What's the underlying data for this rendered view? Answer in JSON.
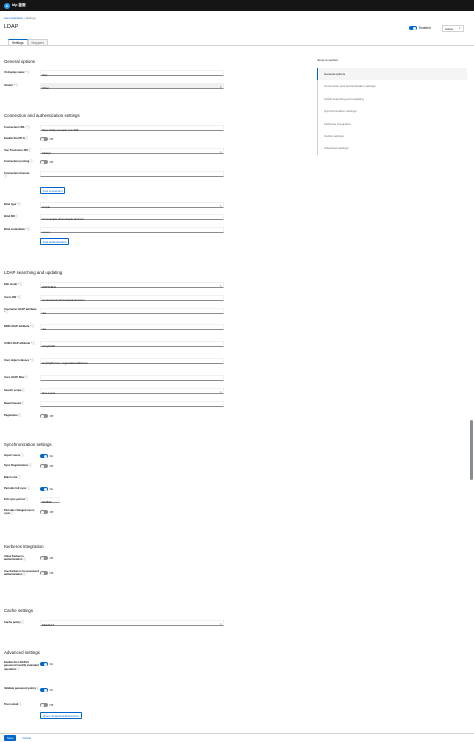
{
  "header": {
    "brand": "Idp 鉴面",
    "logo_letter": "K"
  },
  "breadcrumb": {
    "parent": "User federation",
    "separator": "›",
    "current": "Settings"
  },
  "page": {
    "title": "LDAP",
    "enabled_label": "Enabled",
    "action_label": "Action",
    "enabled": true
  },
  "tabs": [
    {
      "label": "Settings",
      "active": true
    },
    {
      "label": "Mappers",
      "active": false
    }
  ],
  "jump": {
    "title": "Jump to section",
    "items": [
      {
        "label": "General options",
        "active": true
      },
      {
        "label": "Connection and authentication settings",
        "active": false
      },
      {
        "label": "LDAP searching and updating",
        "active": false
      },
      {
        "label": "Synchronization settings",
        "active": false
      },
      {
        "label": "Kerberos integration",
        "active": false
      },
      {
        "label": "Cache settings",
        "active": false
      },
      {
        "label": "Advanced settings",
        "active": false
      }
    ]
  },
  "general": {
    "title": "General options",
    "ui_display_name_label": "UI display name",
    "ui_display_name_value": "ldap",
    "vendor_label": "Vendor",
    "vendor_value": "Other"
  },
  "connection": {
    "title": "Connection and authentication settings",
    "url_label": "Connection URL",
    "url_value": "https://ldap.example.com:636",
    "starttls_label": "Enable StartTLS",
    "starttls_state": "Off",
    "truststore_label": "Use Truststore SPI",
    "truststore_value": "Always",
    "pooling_label": "Connection pooling",
    "pooling_state": "Off",
    "timeout_label": "Connection timeout",
    "timeout_value": "",
    "test_connection": "Test connection",
    "bind_type_label": "Bind type",
    "bind_type_value": "simple",
    "bind_dn_label": "Bind DN",
    "bind_dn_value": "cn=example,dc=example,dc=com",
    "bind_cred_label": "Bind credentials",
    "bind_cred_value": "••••••••",
    "test_auth": "Test authentication"
  },
  "searching": {
    "title": "LDAP searching and updating",
    "edit_mode_label": "Edit mode",
    "edit_mode_value": "WRITABLE",
    "users_dn_label": "Users DN",
    "users_dn_value": "ou=accounts,dc=example,dc=com",
    "username_attr_label": "Username LDAP attribute",
    "username_attr_value": "uid",
    "rdn_attr_label": "RDN LDAP attribute",
    "rdn_attr_value": "uid",
    "uuid_attr_label": "UUID LDAP attribute",
    "uuid_attr_value": "entryUUID",
    "object_classes_label": "User object classes",
    "object_classes_value": "inetOrgPerson, organizationalPerson",
    "user_filter_label": "User LDAP filter",
    "user_filter_value": "",
    "search_scope_label": "Search scope",
    "search_scope_value": "One Level",
    "read_timeout_label": "Read timeout",
    "read_timeout_value": "",
    "pagination_label": "Pagination",
    "pagination_state": "Off"
  },
  "sync": {
    "title": "Synchronization settings",
    "import_label": "Import users",
    "import_state": "On",
    "sync_reg_label": "Sync Registrations",
    "sync_reg_state": "Off",
    "batch_label": "Batch size",
    "batch_value": "",
    "full_sync_label": "Periodic full sync",
    "full_sync_state": "On",
    "full_period_label": "Full sync period",
    "full_period_value": "604800",
    "changed_sync_label": "Periodic changed users sync",
    "changed_sync_state": "Off"
  },
  "kerberos": {
    "title": "Kerberos integration",
    "allow_label": "Allow Kerberos authentication",
    "allow_state": "Off",
    "use_pw_label": "Use Kerberos for password authentication",
    "use_pw_state": "Off"
  },
  "cache": {
    "title": "Cache settings",
    "policy_label": "Cache policy",
    "policy_value": "DEFAULT"
  },
  "advanced": {
    "title": "Advanced settings",
    "ext_pw_label": "Enable the LDAPv3 password modify extended operation",
    "ext_pw_state": "On",
    "validate_label": "Validate password policy",
    "validate_state": "On",
    "trust_email_label": "Trust email",
    "trust_email_state": "Off",
    "query_button": "Query Supported Extensions"
  },
  "footer": {
    "save": "Save",
    "cancel": "Cancel"
  },
  "icons": {
    "help": "question-circle-icon",
    "caret": "caret-down-icon"
  },
  "colors": {
    "accent": "#0066cc",
    "header_bg": "#151515",
    "required": "#c9190b"
  }
}
